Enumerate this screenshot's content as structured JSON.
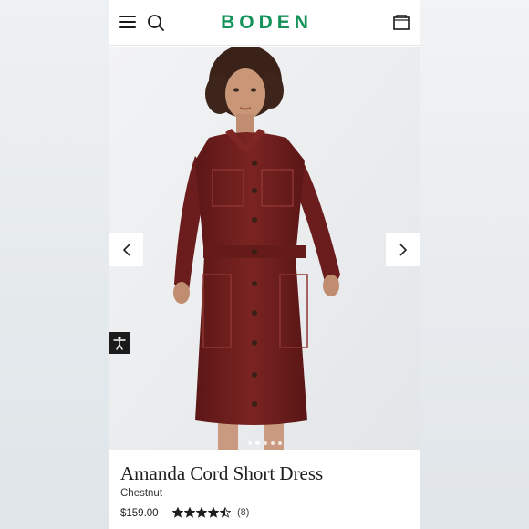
{
  "header": {
    "logo": "BODEN",
    "menu_icon": "hamburger-menu-icon",
    "search_icon": "search-icon",
    "bag_icon": "shopping-bag-icon",
    "brand_color": "#15925a"
  },
  "hero": {
    "prev_icon": "chevron-left-icon",
    "next_icon": "chevron-right-icon",
    "accessibility_icon": "accessibility-icon",
    "dress_color": "#6e1d1c",
    "carousel": {
      "total": 5,
      "active": 1
    }
  },
  "product": {
    "title": "Amanda Cord Short Dress",
    "color": "Chestnut",
    "price": "$159.00",
    "rating": 4.5,
    "rating_max": 5,
    "review_count": "(8)"
  }
}
